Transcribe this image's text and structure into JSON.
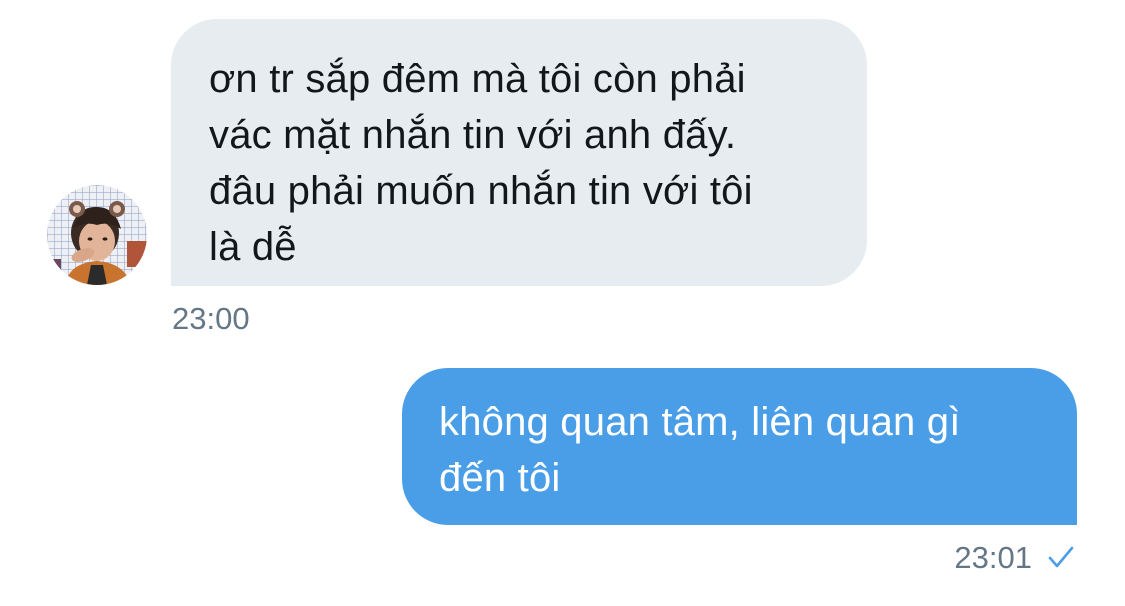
{
  "incoming": {
    "avatar_icon": "user-avatar",
    "lines": [
      "ơn tr sắp đêm mà tôi còn phải",
      "vác mặt nhắn tin với anh đấy.",
      "đâu phải muốn nhắn tin với tôi",
      "là dễ"
    ],
    "time": "23:00"
  },
  "outgoing": {
    "lines": [
      "không quan tâm, liên quan gì",
      "đến tôi"
    ],
    "time": "23:01",
    "status_icon": "sent-check-icon"
  },
  "colors": {
    "incoming_bubble": "#e6ecf0",
    "outgoing_bubble": "#4a9ee7",
    "timestamp": "#657786",
    "check": "#4a9ee7"
  }
}
